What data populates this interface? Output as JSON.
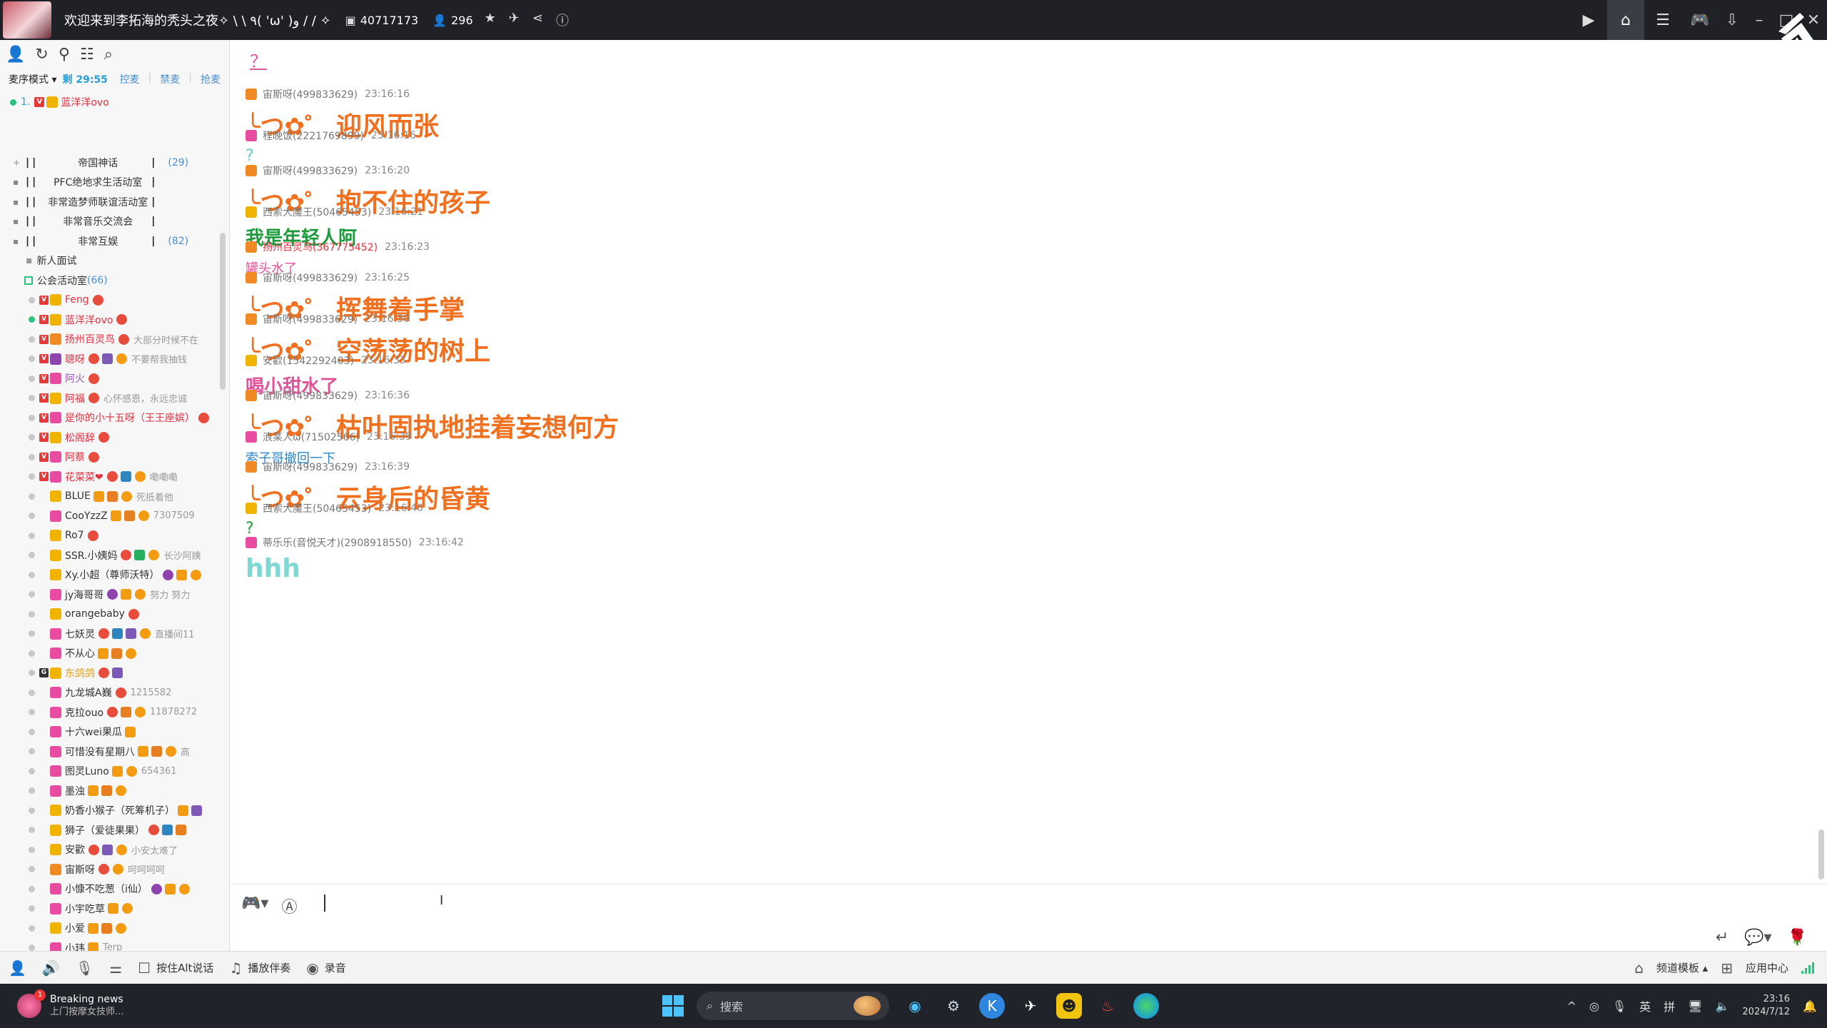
{
  "titlebar": {
    "channel_title": "欢迎来到李拓海的秃头之夜✧ \\ \\ ٩( 'ω' )و / / ✧",
    "channel_id": "40717173",
    "online_count": "296"
  },
  "left": {
    "mode_label": "麦序模式 ▾",
    "mode_left": "剩 29:55",
    "mode_actions": [
      "控麦",
      "禁麦",
      "抢麦"
    ],
    "queue_index": "1.",
    "queue_name": "蓝洋洋ovo",
    "subchannels": [
      {
        "name": "帝国神话",
        "count": "(29)"
      },
      {
        "name": "PFC绝地求生活动室",
        "count": ""
      },
      {
        "name": "非常造梦师联谊活动室",
        "count": ""
      },
      {
        "name": "非常音乐交流会",
        "count": ""
      },
      {
        "name": "非常互娱",
        "count": "(82)"
      }
    ],
    "newbie_room": "新人面试",
    "guild_room": "公会活动室",
    "guild_count": "(66)",
    "users": [
      {
        "name": "Feng",
        "note": ""
      },
      {
        "name": "蓝洋洋ovo",
        "note": ""
      },
      {
        "name": "扬州百灵鸟",
        "note": "大部分时候不在"
      },
      {
        "name": "聰呀",
        "note": "不要帮我抽钱"
      },
      {
        "name": "阿火",
        "note": ""
      },
      {
        "name": "阿福",
        "note": "心怀感恩，永远忠诚"
      },
      {
        "name": "是你的小十五呀（王王座嫔）",
        "note": ""
      },
      {
        "name": "松阁辞",
        "note": ""
      },
      {
        "name": "阿蔡",
        "note": ""
      },
      {
        "name": "花菜菜❤",
        "note": "嘞嘞嘞"
      },
      {
        "name": "BLUE",
        "note": "死抵着他"
      },
      {
        "name": "CooYzzZ",
        "note": "7307509"
      },
      {
        "name": "Ro7",
        "note": ""
      },
      {
        "name": "SSR.小姨妈",
        "note": "长沙阿姨"
      },
      {
        "name": "Xy.小超（尊师沃特）",
        "note": ""
      },
      {
        "name": "jy海哥哥",
        "note": "努力 努力"
      },
      {
        "name": "orangebaby",
        "note": ""
      },
      {
        "name": "七妖灵",
        "note": "直播间11"
      },
      {
        "name": "不从心",
        "note": ""
      },
      {
        "name": "东鸽鸽",
        "note": ""
      },
      {
        "name": "九龙城A巍",
        "note": "1215582"
      },
      {
        "name": "克拉ouo",
        "note": "11878272"
      },
      {
        "name": "十六wei果瓜",
        "note": ""
      },
      {
        "name": "可惜没有星期八",
        "note": "高"
      },
      {
        "name": "图灵Luno",
        "note": "654361"
      },
      {
        "name": "墨浊",
        "note": ""
      },
      {
        "name": "奶香小猴子（死筹机子）",
        "note": ""
      },
      {
        "name": "狮子（爱徒果果）",
        "note": ""
      },
      {
        "name": "安歡",
        "note": "小安太难了"
      },
      {
        "name": "宙斯呀",
        "note": "呵呵呵呵"
      },
      {
        "name": "小慷不吃葱（i仙）",
        "note": ""
      },
      {
        "name": "小宇吃草",
        "note": ""
      },
      {
        "name": "小爱",
        "note": ""
      },
      {
        "name": "小玮",
        "note": "Terp"
      }
    ]
  },
  "chat": {
    "top_fragment": "？",
    "messages": [
      {
        "user": "宙斯呀(499833629)",
        "time": "23:16:16",
        "kaomoji": "╰つ✿゜",
        "text": "迎风而张",
        "style": "big-orange"
      },
      {
        "user": "程晚饭(2221769899)",
        "time": "23:16:16",
        "text": "?",
        "style": "teal-q"
      },
      {
        "user": "宙斯呀(499833629)",
        "time": "23:16:20",
        "kaomoji": "╰つ✿゜",
        "text": "抱不住的孩子",
        "style": "big-orange"
      },
      {
        "user": "西索大魔王(50465453)",
        "time": "23:16:21",
        "text": "我是年轻人阿",
        "style": "green"
      },
      {
        "user": "扬州百灵鸟(367775452)",
        "time": "23:16:23",
        "text": "罐头水了",
        "style": "pink"
      },
      {
        "user": "宙斯呀(499833629)",
        "time": "23:16:25",
        "kaomoji": "╰つ✿゜",
        "text": "挥舞着手掌",
        "style": "big-orange"
      },
      {
        "user": "宙斯呀(499833629)",
        "time": "23:16:30",
        "kaomoji": "╰つ✿゜",
        "text": "空荡荡的树上",
        "style": "big-orange"
      },
      {
        "user": "安歡(1542292403)",
        "time": "23:16:33",
        "text": "喝小甜水了",
        "style": "pink-big"
      },
      {
        "user": "宙斯呀(499833629)",
        "time": "23:16:36",
        "kaomoji": "╰つ✿゜",
        "text": "枯叶固执地挂着妄想何方",
        "style": "big-orange"
      },
      {
        "user": "浪某人ω(71502566)",
        "time": "23:16:39",
        "text": "索子哥撤回一下",
        "style": "blue"
      },
      {
        "user": "宙斯呀(499833629)",
        "time": "23:16:39",
        "kaomoji": "╰つ✿゜",
        "text": "云身后的昏黄",
        "style": "big-orange"
      },
      {
        "user": "西索大魔王(50465453)",
        "time": "23:16:40",
        "text": "?",
        "style": "green-q"
      },
      {
        "user": "蒂乐乐(音悦天才)(2908918550)",
        "time": "23:16:42",
        "text": "hhh",
        "style": "hhh"
      }
    ]
  },
  "bottombar": {
    "ptt_label": "按住Alt说话",
    "accompany_label": "播放伴奏",
    "record_label": "录音",
    "template_label": "频道模板 ▴",
    "app_center_label": "应用中心"
  },
  "taskbar": {
    "news_title": "Breaking news",
    "news_sub": "上门按摩女技师...",
    "news_badge": "1",
    "search_placeholder": "搜索",
    "ime_lang": "英",
    "ime_mode": "拼",
    "time": "23:16",
    "date": "2024/7/12"
  }
}
